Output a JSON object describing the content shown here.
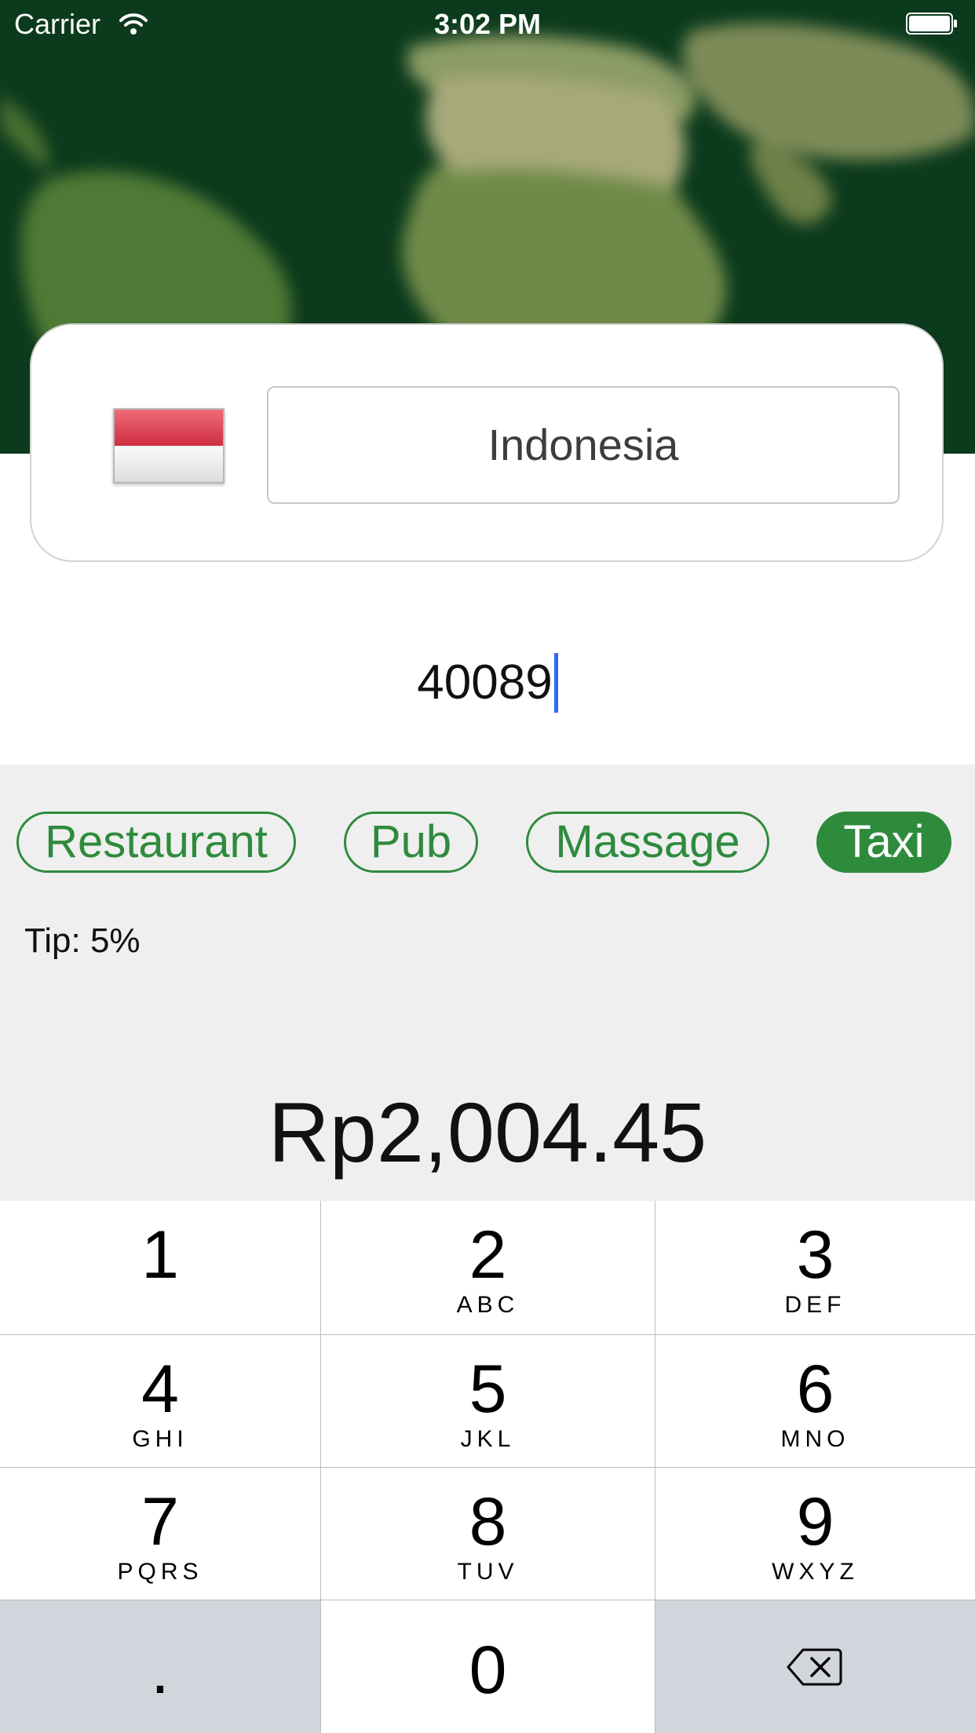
{
  "status_bar": {
    "carrier": "Carrier",
    "time": "3:02 PM"
  },
  "country": {
    "name": "Indonesia",
    "flag_icon": "indonesia-flag-icon"
  },
  "amount": {
    "value": "40089"
  },
  "categories": [
    {
      "label": "Restaurant",
      "selected": false
    },
    {
      "label": "Pub",
      "selected": false
    },
    {
      "label": "Massage",
      "selected": false
    },
    {
      "label": "Taxi",
      "selected": true
    }
  ],
  "tip": {
    "text": "Tip: 5%"
  },
  "total": {
    "text": "Rp2,004.45"
  },
  "keypad": {
    "keys": [
      {
        "digit": "1",
        "letters": ""
      },
      {
        "digit": "2",
        "letters": "ABC"
      },
      {
        "digit": "3",
        "letters": "DEF"
      },
      {
        "digit": "4",
        "letters": "GHI"
      },
      {
        "digit": "5",
        "letters": "JKL"
      },
      {
        "digit": "6",
        "letters": "MNO"
      },
      {
        "digit": "7",
        "letters": "PQRS"
      },
      {
        "digit": "8",
        "letters": "TUV"
      },
      {
        "digit": "9",
        "letters": "WXYZ"
      }
    ],
    "decimal": ".",
    "zero": "0",
    "delete_icon": "backspace-icon"
  },
  "colors": {
    "accent": "#2e8b3c",
    "caret": "#2f6bf0",
    "panel_bg": "#efefef",
    "keypad_gray": "#d2d5db",
    "map_bg": "#0d3b1f"
  }
}
